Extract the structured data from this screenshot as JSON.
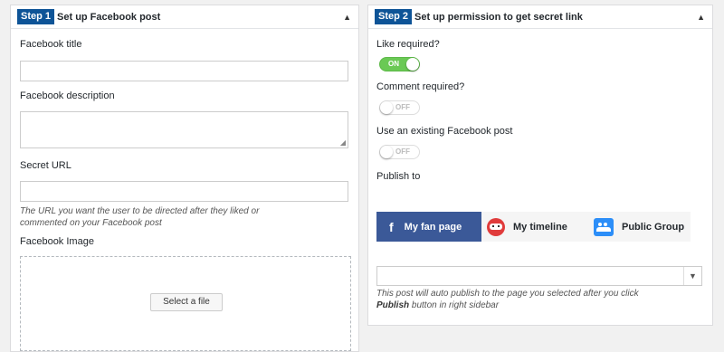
{
  "step1": {
    "badge": "Step 1",
    "title": "Set up Facebook post",
    "fb_title_label": "Facebook title",
    "fb_title_value": "",
    "fb_desc_label": "Facebook description",
    "fb_desc_value": "",
    "secret_url_label": "Secret URL",
    "secret_url_value": "",
    "secret_url_help_1": "The URL you want the user to be directed after they liked or",
    "secret_url_help_2": "commented on your Facebook post",
    "image_label": "Facebook Image",
    "select_file": "Select a file"
  },
  "step2": {
    "badge": "Step 2",
    "title": "Set up permission to get secret link",
    "like_label": "Like required?",
    "like_state": "ON",
    "comment_label": "Comment required?",
    "comment_state": "OFF",
    "existing_label": "Use an existing Facebook post",
    "existing_state": "OFF",
    "publish_label": "Publish to",
    "tabs": [
      {
        "label": "My fan page",
        "icon": "facebook-icon",
        "active": true
      },
      {
        "label": "My timeline",
        "icon": "robot-icon",
        "active": false
      },
      {
        "label": "Public Group",
        "icon": "group-icon",
        "active": false
      }
    ],
    "page_select_value": "",
    "publish_help_1": "This post will auto publish to the page you selected after you click",
    "publish_help_bold": "Publish",
    "publish_help_2": "button in right sidebar"
  },
  "colors": {
    "badge": "#0e5497",
    "toggle_on": "#6ac955",
    "facebook": "#3b5998"
  }
}
